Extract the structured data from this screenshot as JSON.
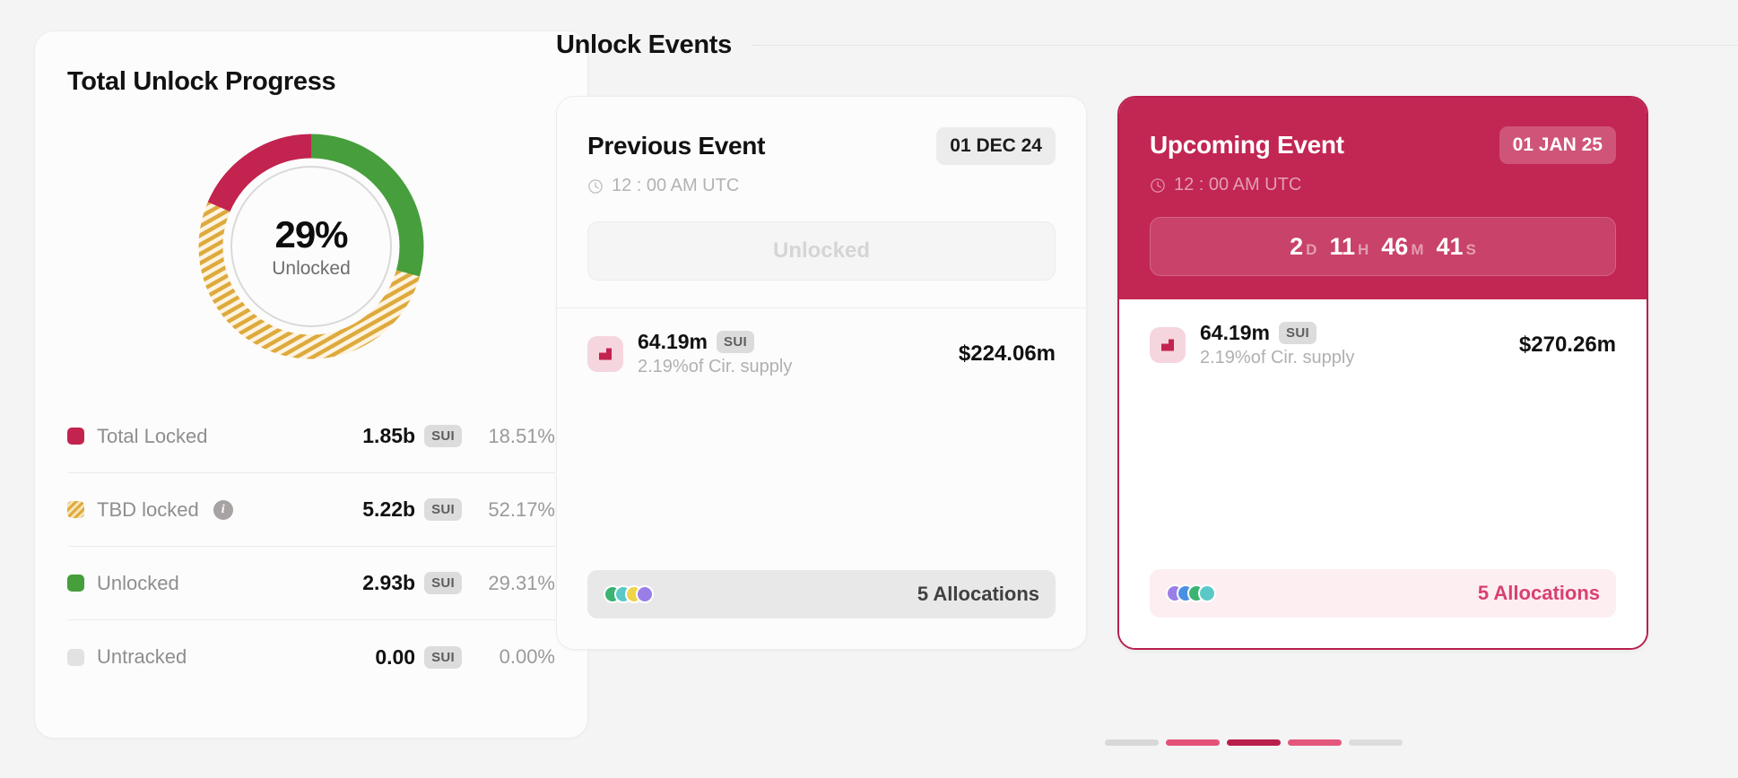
{
  "progress_card": {
    "title": "Total Unlock Progress",
    "donut": {
      "center_value": "29%",
      "center_label": "Unlocked"
    },
    "legend": [
      {
        "label": "Total Locked",
        "amount": "1.85b",
        "ticker": "SUI",
        "percent": "18.51%",
        "color": "#c2234f",
        "swatch": "solid",
        "info": false
      },
      {
        "label": "TBD locked",
        "amount": "5.22b",
        "ticker": "SUI",
        "percent": "52.17%",
        "color": "#e0ac3c",
        "swatch": "hatch",
        "info": true
      },
      {
        "label": "Unlocked",
        "amount": "2.93b",
        "ticker": "SUI",
        "percent": "29.31%",
        "color": "#479e3c",
        "swatch": "solid",
        "info": false
      },
      {
        "label": "Untracked",
        "amount": "0.00",
        "ticker": "SUI",
        "percent": "0.00%",
        "color": "#e2e2e2",
        "swatch": "solid",
        "info": false
      }
    ]
  },
  "events_section": {
    "title": "Unlock Events",
    "previous": {
      "title": "Previous Event",
      "date": "01 DEC 24",
      "time": "12 : 00 AM UTC",
      "status": "Unlocked",
      "token": {
        "amount": "64.19m",
        "ticker": "SUI",
        "supply_note": "2.19%of Cir. supply",
        "usd_value": "$224.06m"
      },
      "allocations_label": "5 Allocations",
      "avatar_colors": [
        "#3cb371",
        "#5bc8c8",
        "#efd44a",
        "#9a7ee8"
      ]
    },
    "upcoming": {
      "title": "Upcoming Event",
      "date": "01 JAN 25",
      "time": "12 : 00 AM UTC",
      "countdown": [
        {
          "value": "2",
          "unit": "D"
        },
        {
          "value": "11",
          "unit": "H"
        },
        {
          "value": "46",
          "unit": "M"
        },
        {
          "value": "41",
          "unit": "S"
        }
      ],
      "token": {
        "amount": "64.19m",
        "ticker": "SUI",
        "supply_note": "2.19%of Cir. supply",
        "usd_value": "$270.26m"
      },
      "allocations_label": "5 Allocations",
      "avatar_colors": [
        "#9a7ee8",
        "#4a90e2",
        "#3cb371",
        "#5bc8c8"
      ]
    },
    "pagination": [
      {
        "color": "#d8d8d8"
      },
      {
        "color": "#e45278"
      },
      {
        "color": "#b81f4c"
      },
      {
        "color": "#e4577c"
      },
      {
        "color": "#dcdcdc"
      }
    ]
  },
  "chart_data": {
    "type": "pie",
    "title": "Total Unlock Progress",
    "labels": [
      "Unlocked",
      "TBD locked",
      "Total Locked",
      "Untracked"
    ],
    "values": [
      29.31,
      52.17,
      18.51,
      0.0
    ],
    "amounts": [
      "2.93b",
      "5.22b",
      "1.85b",
      "0.00"
    ],
    "unit": "SUI",
    "colors": [
      "#479e3c",
      "#e0ac3c",
      "#c2234f",
      "#e2e2e2"
    ],
    "center_value": "29%",
    "center_label": "Unlocked",
    "legend_position": "bottom",
    "donut": true
  }
}
